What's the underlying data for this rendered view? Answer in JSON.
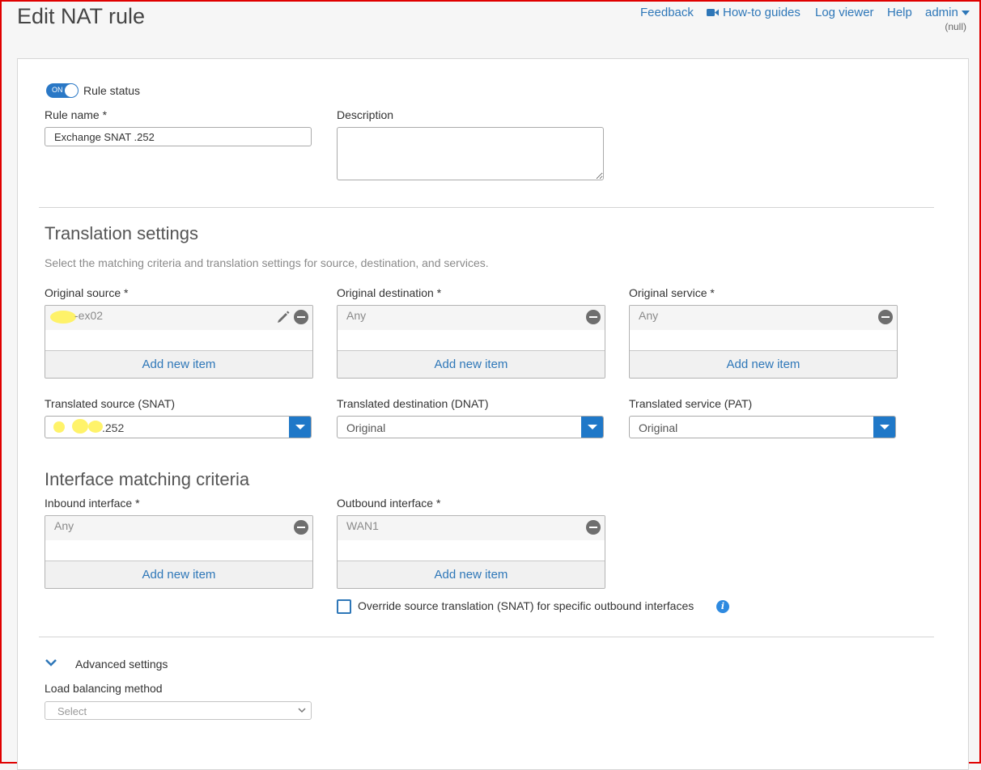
{
  "header": {
    "title": "Edit NAT rule",
    "links": {
      "feedback": "Feedback",
      "howto": "How-to guides",
      "logviewer": "Log viewer",
      "help": "Help",
      "user": "admin"
    },
    "user_sub": "(null)"
  },
  "rule": {
    "status_label": "Rule status",
    "toggle_text": "ON",
    "name_label": "Rule name *",
    "name_value": "Exchange SNAT .252",
    "description_label": "Description",
    "description_value": ""
  },
  "translation": {
    "title": "Translation settings",
    "hint": "Select the matching criteria and translation settings for source, destination, and services.",
    "original_source": {
      "label": "Original source *",
      "item": "-ex02",
      "add": "Add new item"
    },
    "original_destination": {
      "label": "Original destination *",
      "item": "Any",
      "add": "Add new item"
    },
    "original_service": {
      "label": "Original service *",
      "item": "Any",
      "add": "Add new item"
    },
    "translated_source": {
      "label": "Translated source (SNAT)",
      "value": ".252"
    },
    "translated_destination": {
      "label": "Translated destination (DNAT)",
      "value": "Original"
    },
    "translated_service": {
      "label": "Translated service (PAT)",
      "value": "Original"
    }
  },
  "interface": {
    "title": "Interface matching criteria",
    "inbound": {
      "label": "Inbound interface *",
      "item": "Any",
      "add": "Add new item"
    },
    "outbound": {
      "label": "Outbound interface *",
      "item": "WAN1",
      "add": "Add new item"
    },
    "override_label": "Override source translation (SNAT) for specific outbound interfaces",
    "override_checked": false
  },
  "advanced": {
    "label": "Advanced settings",
    "lb_label": "Load balancing method",
    "lb_placeholder": "Select"
  },
  "colors": {
    "accent": "#2e77b8",
    "select_button": "#1f78c8",
    "screenshot_border": "#e00000",
    "redaction": "#fff25a"
  }
}
